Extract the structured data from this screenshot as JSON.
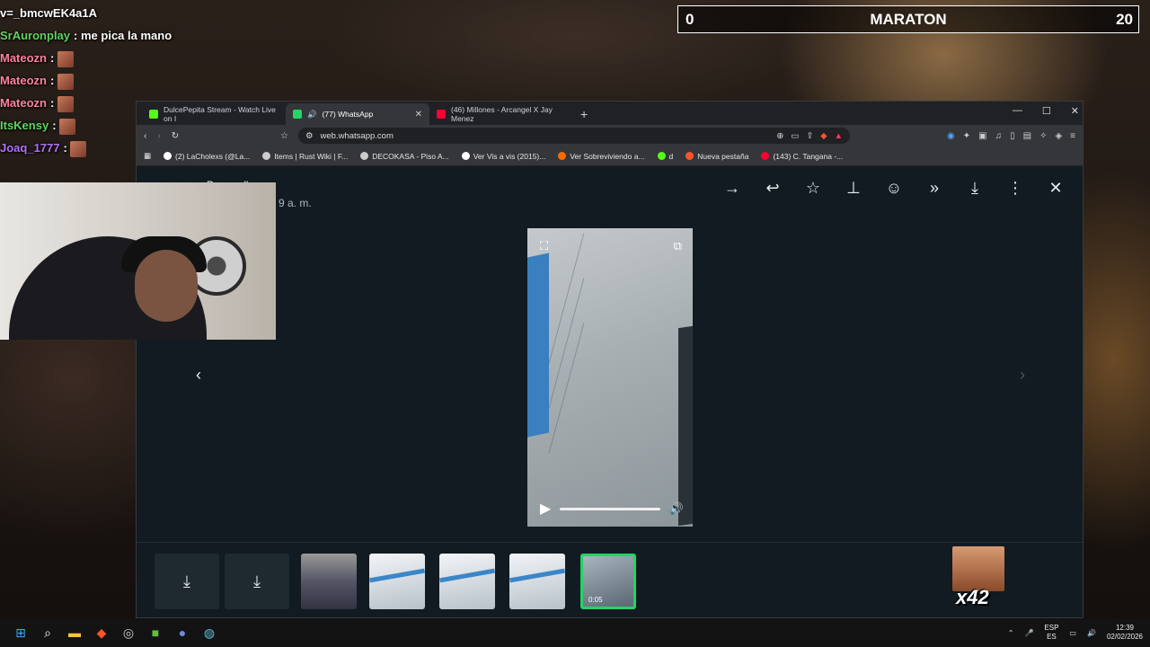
{
  "chat": {
    "header": "v=_bmcwEK4a1A",
    "lines": [
      {
        "user": "SrAuronplay",
        "sep": ":",
        "msg": "me pica la mano",
        "color": "#5fd35f"
      },
      {
        "user": "Mateozn",
        "sep": ":",
        "msg": "",
        "color": "#ff80a0"
      },
      {
        "user": "Mateozn",
        "sep": ":",
        "msg": "",
        "color": "#ff80a0"
      },
      {
        "user": "Mateozn",
        "sep": ":",
        "msg": "",
        "color": "#ff80a0"
      },
      {
        "user": "ItsKensy",
        "sep": ":",
        "msg": "",
        "color": "#5fd35f"
      },
      {
        "user": "Joaq_1777",
        "sep": ":",
        "msg": "",
        "color": "#b070ff"
      }
    ]
  },
  "scoreboard": {
    "left": "0",
    "title": "MARATON",
    "right": "20"
  },
  "browser": {
    "tabs": [
      {
        "label": "DulcePepita Stream - Watch Live on I",
        "favcolor": "#53fc18",
        "active": false
      },
      {
        "label": "(77) WhatsApp",
        "favcolor": "#25d366",
        "active": true
      },
      {
        "label": "(46) Millones - Arcangel X Jay Menez",
        "favcolor": "#ff0033",
        "active": false
      }
    ],
    "url": "web.whatsapp.com",
    "bookmarks": [
      {
        "label": "(2) LaCholexs (@La...",
        "color": "#ffffff"
      },
      {
        "label": "Items | Rust Wiki | F...",
        "color": "#cccccc"
      },
      {
        "label": "DECOKASA - Piso A...",
        "color": "#cccccc"
      },
      {
        "label": "Ver Vis a vis (2015)...",
        "color": "#ffffff"
      },
      {
        "label": "Ver Sobreviviendo a...",
        "color": "#ff6a00"
      },
      {
        "label": "d",
        "color": "#53fc18"
      },
      {
        "label": "Nueva pestaña",
        "color": "#fb542b"
      },
      {
        "label": "(143) C. Tangana -...",
        "color": "#ff0033"
      }
    ]
  },
  "viewer": {
    "sender_name": "Brayan l'ze",
    "time": "9 a. m.",
    "video_duration": "0:05"
  },
  "overlay": {
    "emote_count": "x42"
  },
  "taskbar": {
    "lang_top": "ESP",
    "lang_bottom": "ES",
    "time": "12:39",
    "date": "02/02/2026"
  }
}
